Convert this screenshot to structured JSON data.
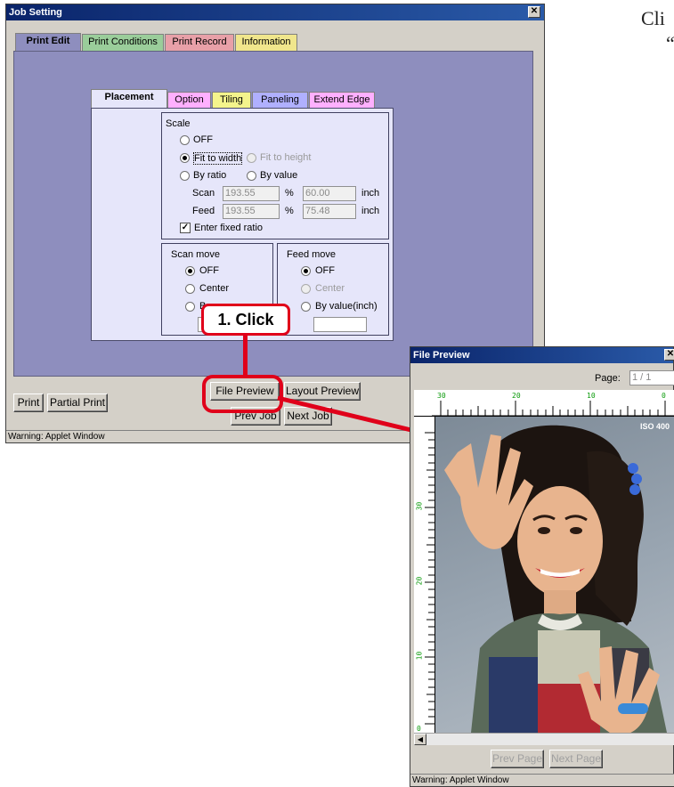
{
  "job_setting": {
    "title": "Job Setting",
    "close_glyph": "✕",
    "tabs": [
      "Print Edit",
      "Print Conditions",
      "Print Record",
      "Information"
    ],
    "tab_colors": [
      "#8e8ebe",
      "#9acd9a",
      "#e8a0a8",
      "#f0e68c"
    ],
    "sub_tabs": [
      "Placement",
      "Option",
      "Tiling",
      "Paneling",
      "Extend Edge"
    ],
    "sub_tab_colors": [
      "#e6e6fa",
      "#ffb0ff",
      "#f4f48c",
      "#b0b0ff",
      "#ffb0ff"
    ],
    "scale": {
      "title": "Scale",
      "off": "OFF",
      "fit_to_width": "Fit to width",
      "fit_to_height": "Fit to height",
      "by_ratio": "By ratio",
      "by_value": "By value",
      "scan_label": "Scan",
      "scan_ratio": "193.55",
      "scan_value": "60.00",
      "feed_label": "Feed",
      "feed_ratio": "193.55",
      "feed_value": "75.48",
      "percent": "%",
      "unit": "inch",
      "fixed_ratio": "Enter fixed ratio"
    },
    "scan_move": {
      "title": "Scan move",
      "off": "OFF",
      "center": "Center",
      "by_value_partial": "B"
    },
    "feed_move": {
      "title": "Feed move",
      "off": "OFF",
      "center": "Center",
      "by_value": "By value(inch)"
    },
    "buttons": {
      "file_preview": "File Preview",
      "layout_preview": "Layout Preview",
      "print": "Print",
      "partial_print": "Partial Print",
      "prev_job": "Prev Job",
      "next_job": "Next Job"
    },
    "status": "Warning: Applet Window"
  },
  "callout": {
    "click_label": "1. Click"
  },
  "file_preview": {
    "title": "File Preview",
    "close_glyph": "✕",
    "page_label": "Page:",
    "page_value": "1 / 1",
    "ruler_top": [
      "30",
      "20",
      "10",
      "0"
    ],
    "ruler_left": [
      "30",
      "20",
      "10",
      "0"
    ],
    "photo_tag": "ISO 400",
    "prev_page": "Prev Page",
    "next_page": "Next Page",
    "status": "Warning: Applet Window"
  },
  "side_text": {
    "line1": "Cli",
    "line2": "“"
  }
}
